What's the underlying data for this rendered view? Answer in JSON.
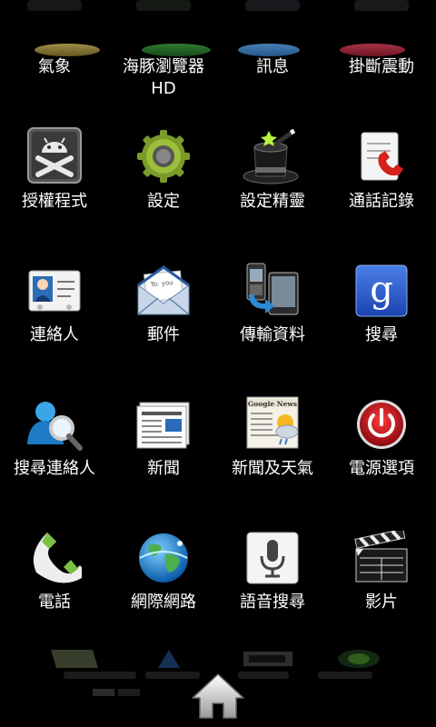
{
  "launcher": {
    "ghost_top_labels": [
      "",
      "",
      "",
      ""
    ],
    "row0": [
      {
        "label": "氣象",
        "icon": "weather-icon"
      },
      {
        "label": "海豚瀏覽器 HD",
        "icon": "dolphin-browser-icon"
      },
      {
        "label": "訊息",
        "icon": "messages-icon"
      },
      {
        "label": "掛斷震動",
        "icon": "hangup-vibrate-icon"
      }
    ],
    "row1": [
      {
        "label": "授權程式",
        "icon": "superuser-icon"
      },
      {
        "label": "設定",
        "icon": "gear-icon"
      },
      {
        "label": "設定精靈",
        "icon": "magic-hat-icon"
      },
      {
        "label": "通話記錄",
        "icon": "call-log-icon"
      }
    ],
    "row2": [
      {
        "label": "連絡人",
        "icon": "contacts-icon"
      },
      {
        "label": "郵件",
        "icon": "email-icon"
      },
      {
        "label": "傳輸資料",
        "icon": "transfer-data-icon"
      },
      {
        "label": "搜尋",
        "icon": "google-search-icon"
      }
    ],
    "row3": [
      {
        "label": "搜尋連絡人",
        "icon": "search-contacts-icon"
      },
      {
        "label": "新聞",
        "icon": "news-icon"
      },
      {
        "label": "新聞及天氣",
        "icon": "news-weather-icon"
      },
      {
        "label": "電源選項",
        "icon": "power-icon"
      }
    ],
    "row4": [
      {
        "label": "電話",
        "icon": "phone-icon"
      },
      {
        "label": "網際網路",
        "icon": "globe-icon"
      },
      {
        "label": "語音搜尋",
        "icon": "voice-search-icon"
      },
      {
        "label": "影片",
        "icon": "clapperboard-icon"
      }
    ],
    "news_weather_badge": "Google News",
    "email_badge": "To: you",
    "google_letter": "g"
  },
  "dock": {
    "home_icon": "home-icon"
  },
  "colors": {
    "background": "#000000",
    "label": "#ffffff",
    "google_blue": "#2a5bd7",
    "power_red": "#c0101a",
    "phone_green": "#7bc043"
  }
}
